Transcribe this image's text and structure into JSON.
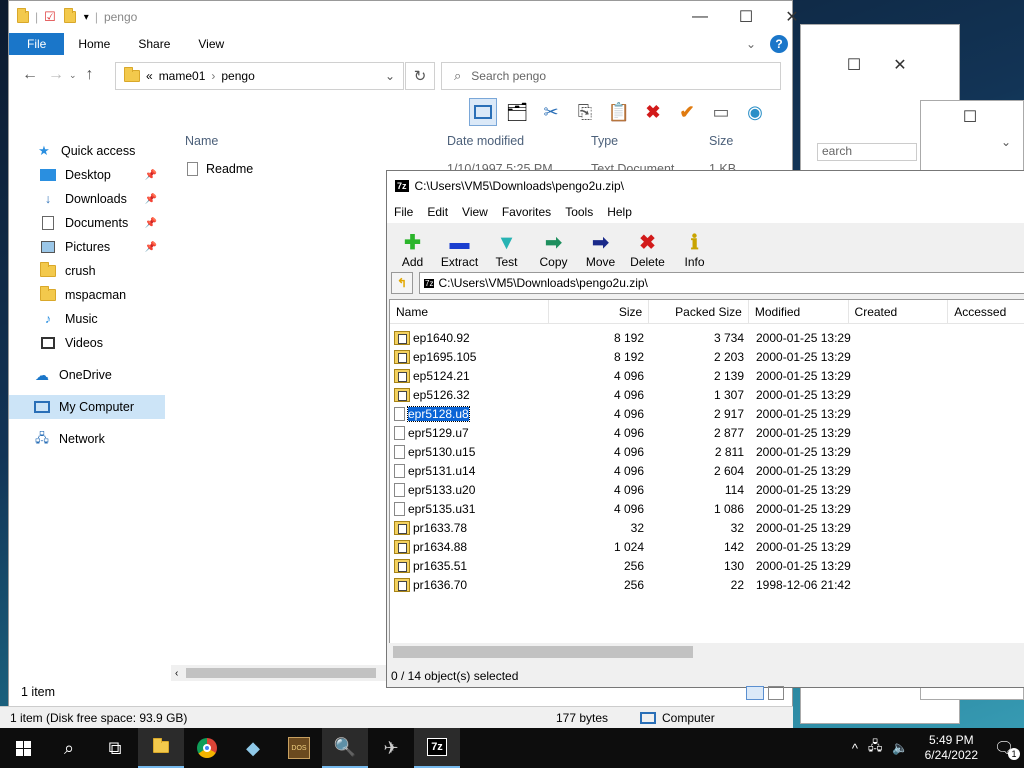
{
  "explorer": {
    "title": "pengo",
    "tabs": [
      "File",
      "Home",
      "Share",
      "View"
    ],
    "breadcrumb": [
      "mame01",
      "pengo"
    ],
    "breadcrumb_prefix": "«",
    "search_placeholder": "Search pengo",
    "nav": [
      {
        "label": "Quick access",
        "icon": "star-icon"
      },
      {
        "label": "Desktop",
        "icon": "desktop-icon",
        "pinned": true
      },
      {
        "label": "Downloads",
        "icon": "download-icon",
        "pinned": true
      },
      {
        "label": "Documents",
        "icon": "documents-icon",
        "pinned": true
      },
      {
        "label": "Pictures",
        "icon": "pictures-icon",
        "pinned": true
      },
      {
        "label": "crush",
        "icon": "folder-icon"
      },
      {
        "label": "mspacman",
        "icon": "folder-icon"
      },
      {
        "label": "Music",
        "icon": "music-icon"
      },
      {
        "label": "Videos",
        "icon": "videos-icon"
      },
      {
        "label": "OneDrive",
        "icon": "cloud-icon"
      },
      {
        "label": "My Computer",
        "icon": "computer-icon",
        "selected": true
      },
      {
        "label": "Network",
        "icon": "network-icon"
      }
    ],
    "columns": [
      "Name",
      "Date modified",
      "Type",
      "Size"
    ],
    "files": [
      {
        "name": "Readme",
        "date": "1/10/1997 5:25 PM",
        "type": "Text Document",
        "size": "1 KB"
      }
    ],
    "item_count": "1 item",
    "status_left": "1 item (Disk free space: 93.9 GB)",
    "status_size": "177 bytes",
    "status_location": "Computer"
  },
  "bg_search_fragment": "earch",
  "sevenzip": {
    "title": "C:\\Users\\VM5\\Downloads\\pengo2u.zip\\",
    "menu": [
      "File",
      "Edit",
      "View",
      "Favorites",
      "Tools",
      "Help"
    ],
    "tools": [
      {
        "label": "Add",
        "icon": "add-icon",
        "color": "#2bb52b",
        "glyph": "✚"
      },
      {
        "label": "Extract",
        "icon": "extract-icon",
        "color": "#1a3ecf",
        "glyph": "▬"
      },
      {
        "label": "Test",
        "icon": "test-icon",
        "color": "#27b3b3",
        "glyph": "▼"
      },
      {
        "label": "Copy",
        "icon": "copy-icon",
        "color": "#1e8f5e",
        "glyph": "➡"
      },
      {
        "label": "Move",
        "icon": "move-icon",
        "color": "#1a2a8a",
        "glyph": "➡"
      },
      {
        "label": "Delete",
        "icon": "delete-icon",
        "color": "#d21a1a",
        "glyph": "✖"
      },
      {
        "label": "Info",
        "icon": "info-icon",
        "color": "#c9a400",
        "glyph": "ℹ"
      }
    ],
    "path": "C:\\Users\\VM5\\Downloads\\pengo2u.zip\\",
    "columns": [
      "Name",
      "Size",
      "Packed Size",
      "Modified",
      "Created",
      "Accessed"
    ],
    "rows": [
      {
        "name": "ep1640.92",
        "size": "8 192",
        "packed": "3 734",
        "modified": "2000-01-25 13:29",
        "kind": "zip"
      },
      {
        "name": "ep1695.105",
        "size": "8 192",
        "packed": "2 203",
        "modified": "2000-01-25 13:29",
        "kind": "zip"
      },
      {
        "name": "ep5124.21",
        "size": "4 096",
        "packed": "2 139",
        "modified": "2000-01-25 13:29",
        "kind": "zip"
      },
      {
        "name": "ep5126.32",
        "size": "4 096",
        "packed": "1 307",
        "modified": "2000-01-25 13:29",
        "kind": "zip"
      },
      {
        "name": "epr5128.u8",
        "size": "4 096",
        "packed": "2 917",
        "modified": "2000-01-25 13:29",
        "kind": "doc",
        "selected": true
      },
      {
        "name": "epr5129.u7",
        "size": "4 096",
        "packed": "2 877",
        "modified": "2000-01-25 13:29",
        "kind": "doc"
      },
      {
        "name": "epr5130.u15",
        "size": "4 096",
        "packed": "2 811",
        "modified": "2000-01-25 13:29",
        "kind": "doc"
      },
      {
        "name": "epr5131.u14",
        "size": "4 096",
        "packed": "2 604",
        "modified": "2000-01-25 13:29",
        "kind": "doc"
      },
      {
        "name": "epr5133.u20",
        "size": "4 096",
        "packed": "114",
        "modified": "2000-01-25 13:29",
        "kind": "doc"
      },
      {
        "name": "epr5135.u31",
        "size": "4 096",
        "packed": "1 086",
        "modified": "2000-01-25 13:29",
        "kind": "doc"
      },
      {
        "name": "pr1633.78",
        "size": "32",
        "packed": "32",
        "modified": "2000-01-25 13:29",
        "kind": "zip"
      },
      {
        "name": "pr1634.88",
        "size": "1 024",
        "packed": "142",
        "modified": "2000-01-25 13:29",
        "kind": "zip"
      },
      {
        "name": "pr1635.51",
        "size": "256",
        "packed": "130",
        "modified": "2000-01-25 13:29",
        "kind": "zip"
      },
      {
        "name": "pr1636.70",
        "size": "256",
        "packed": "22",
        "modified": "1998-12-06 21:42",
        "kind": "zip"
      }
    ],
    "status": "0 / 14 object(s) selected"
  },
  "taskbar": {
    "time": "5:49 PM",
    "date": "6/24/2022",
    "notification_count": "1",
    "apps": [
      "file-explorer-icon",
      "chrome-icon",
      "app-icon",
      "dosbox-icon",
      "search-app-icon",
      "app2-icon",
      "sevenzip-icon"
    ]
  }
}
